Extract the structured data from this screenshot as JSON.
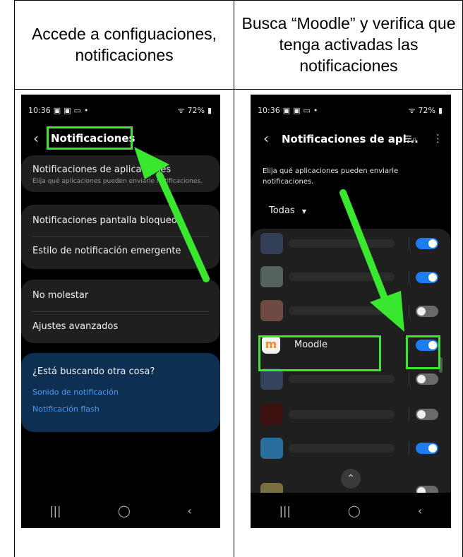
{
  "header": {
    "left": "Accede a configuaciones, notificaciones",
    "right": "Busca “Moodle” y verifica que tenga activadas las notificaciones"
  },
  "phone1": {
    "status_time": "10:36",
    "status_battery": "72%",
    "title": "Notificaciones",
    "items": {
      "app_notifications": "Notificaciones de aplicaciones",
      "app_notifications_sub": "Elija qué aplicaciones pueden enviarle notificaciones.",
      "lock_screen": "Notificaciones pantalla bloqueo",
      "popup_style": "Estilo de notificación emergente",
      "dnd": "No molestar",
      "advanced": "Ajustes avanzados"
    },
    "suggest": {
      "title": "¿Está buscando otra cosa?",
      "link1": "Sonido de notificación",
      "link2": "Notificación flash"
    }
  },
  "phone2": {
    "status_time": "10:36",
    "status_battery": "72%",
    "title": "Notificaciones de apl...",
    "description": "Elija qué aplicaciones pueden enviarle notificaciones.",
    "filter": "Todas",
    "moodle_label": "Moodle",
    "toggles": [
      true,
      true,
      false,
      true,
      false,
      false,
      true
    ]
  },
  "colors": {
    "highlight": "#39e82e",
    "toggle_on": "#1e7bf2",
    "link": "#4a9bf5",
    "suggest_bg": "#0d2f52"
  }
}
